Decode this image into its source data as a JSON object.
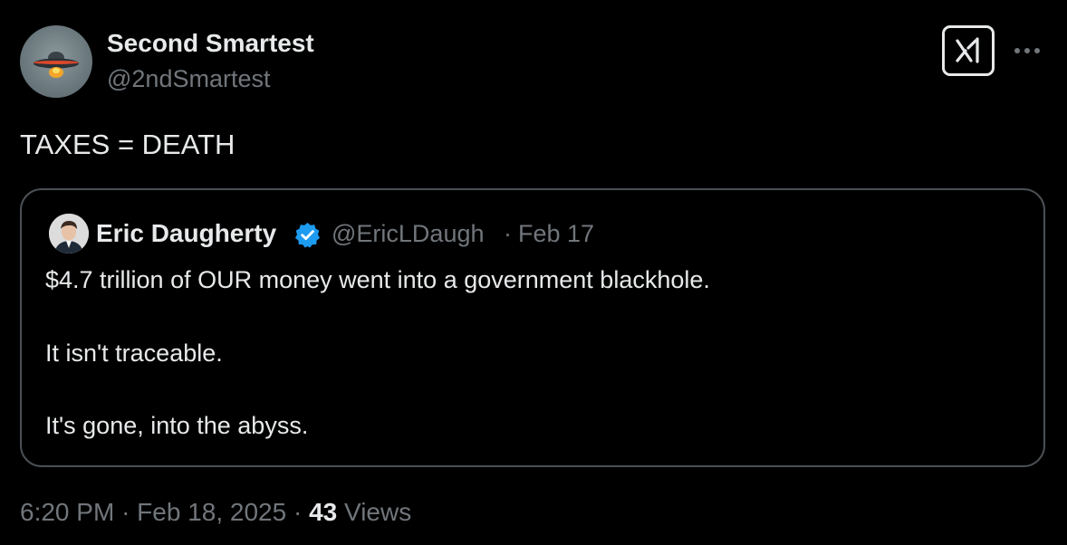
{
  "tweet": {
    "author": {
      "name": "Second Smartest",
      "handle": "@2ndSmartest",
      "avatar_icon": "ufo-avatar"
    },
    "text": "TAXES = DEATH",
    "header_icons": {
      "grok": "grok-icon",
      "more": "more-icon"
    },
    "quoted": {
      "author": {
        "name": "Eric Daugherty",
        "handle": "@EricLDaugh",
        "verified": true,
        "avatar_icon": "profile-photo"
      },
      "separator": "·",
      "date": "Feb 17",
      "lines": [
        "$4.7 trillion of OUR money went into a government blackhole.",
        "It isn't traceable.",
        "It's gone, into the abyss."
      ]
    },
    "meta": {
      "time": "6:20 PM",
      "separator": "·",
      "date": "Feb 18, 2025",
      "views_count": "43",
      "views_label": "Views"
    }
  },
  "colors": {
    "background": "#000000",
    "text_primary": "#e7e9ea",
    "text_secondary": "#71767b",
    "border": "#4b5055",
    "verified_blue": "#1d9bf0"
  }
}
